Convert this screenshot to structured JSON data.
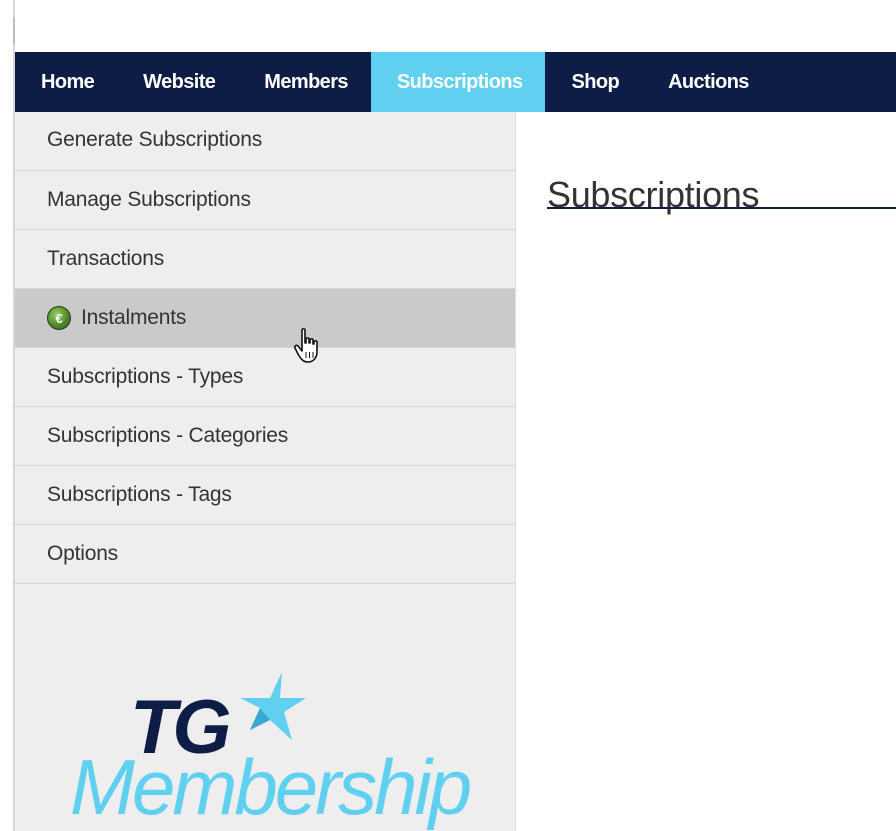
{
  "nav": {
    "items": [
      {
        "label": "Home",
        "active": false
      },
      {
        "label": "Website",
        "active": false
      },
      {
        "label": "Members",
        "active": false
      },
      {
        "label": "Subscriptions",
        "active": true
      },
      {
        "label": "Shop",
        "active": false
      },
      {
        "label": "Auctions",
        "active": false
      }
    ]
  },
  "sidebar": {
    "items": [
      {
        "label": "Generate Subscriptions"
      },
      {
        "label": "Manage Subscriptions"
      },
      {
        "label": "Transactions"
      },
      {
        "label": "Instalments",
        "icon": "e-badge-icon",
        "hovered": true
      },
      {
        "label": "Subscriptions - Types"
      },
      {
        "label": "Subscriptions - Categories"
      },
      {
        "label": "Subscriptions - Tags"
      },
      {
        "label": "Options"
      }
    ]
  },
  "logo": {
    "line1": "TG",
    "line2": "Membership"
  },
  "main": {
    "title": "Subscriptions"
  },
  "colors": {
    "navy": "#0e1d45",
    "accent": "#5fd0ef",
    "sidebar_bg": "#eeeeee",
    "hover_bg": "#cacaca"
  }
}
